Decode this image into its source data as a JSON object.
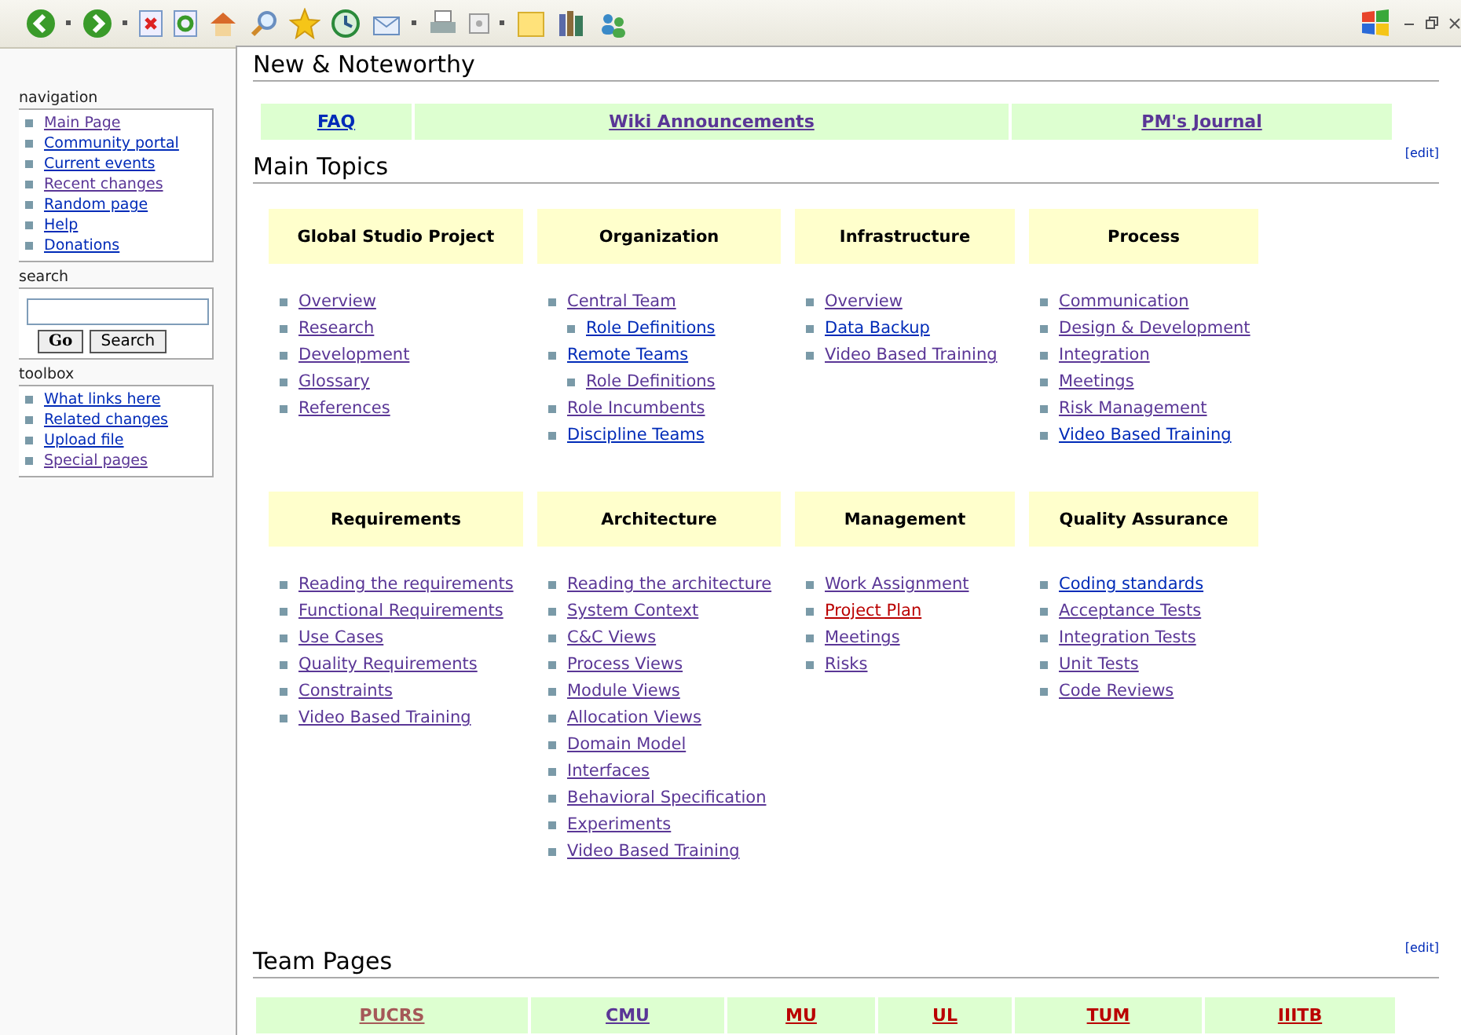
{
  "sidebar": {
    "portlets": [
      {
        "kind": "links",
        "title": "navigation",
        "links": [
          {
            "label": "Main Page",
            "kind": "visited"
          },
          {
            "label": "Community portal",
            "kind": "unvisited"
          },
          {
            "label": "Current events",
            "kind": "unvisited"
          },
          {
            "label": "Recent changes",
            "kind": "visited"
          },
          {
            "label": "Random page",
            "kind": "unvisited"
          },
          {
            "label": "Help",
            "kind": "unvisited"
          },
          {
            "label": "Donations",
            "kind": "unvisited"
          }
        ]
      },
      {
        "kind": "search",
        "title": "search",
        "buttons": [
          "Go",
          "Search"
        ]
      },
      {
        "kind": "links",
        "title": "toolbox",
        "links": [
          {
            "label": "What links here",
            "kind": "unvisited"
          },
          {
            "label": "Related changes",
            "kind": "unvisited"
          },
          {
            "label": "Upload file",
            "kind": "unvisited"
          },
          {
            "label": "Special pages",
            "kind": "visited"
          }
        ]
      }
    ]
  },
  "noteworthy": {
    "heading": "New & Noteworthy",
    "links": [
      {
        "label": "FAQ",
        "kind": "unvisited"
      },
      {
        "label": "Wiki Announcements",
        "kind": "visited"
      },
      {
        "label": "PM's Journal",
        "kind": "visited"
      }
    ]
  },
  "main_topics": {
    "heading": "Main Topics",
    "edit": "[edit]",
    "topics": [
      {
        "title": "Global Studio Project",
        "links": [
          {
            "label": "Overview",
            "kind": "visited"
          },
          {
            "label": "Research",
            "kind": "visited"
          },
          {
            "label": "Development",
            "kind": "visited"
          },
          {
            "label": "Glossary",
            "kind": "visited"
          },
          {
            "label": "References",
            "kind": "visited"
          }
        ]
      },
      {
        "title": "Organization",
        "links": [
          {
            "label": "Central Team",
            "kind": "visited",
            "children": [
              {
                "label": "Role Definitions",
                "kind": "unvisited"
              }
            ]
          },
          {
            "label": "Remote Teams",
            "kind": "unvisited",
            "children": [
              {
                "label": "Role Definitions",
                "kind": "visited"
              }
            ]
          },
          {
            "label": "Role Incumbents",
            "kind": "visited"
          },
          {
            "label": "Discipline Teams",
            "kind": "unvisited"
          }
        ]
      },
      {
        "title": "Infrastructure",
        "links": [
          {
            "label": "Overview",
            "kind": "visited"
          },
          {
            "label": "Data Backup",
            "kind": "unvisited"
          },
          {
            "label": "Video Based Training",
            "kind": "visited"
          }
        ]
      },
      {
        "title": "Process",
        "links": [
          {
            "label": "Communication",
            "kind": "visited"
          },
          {
            "label": "Design & Development",
            "kind": "visited"
          },
          {
            "label": "Integration",
            "kind": "visited"
          },
          {
            "label": "Meetings",
            "kind": "visited"
          },
          {
            "label": "Risk Management",
            "kind": "visited"
          },
          {
            "label": "Video Based Training",
            "kind": "unvisited"
          }
        ]
      },
      {
        "title": "Requirements",
        "links": [
          {
            "label": "Reading the requirements",
            "kind": "visited"
          },
          {
            "label": "Functional Requirements",
            "kind": "visited"
          },
          {
            "label": "Use Cases",
            "kind": "visited"
          },
          {
            "label": "Quality Requirements",
            "kind": "visited"
          },
          {
            "label": "Constraints",
            "kind": "visited"
          },
          {
            "label": "Video Based Training",
            "kind": "visited"
          }
        ]
      },
      {
        "title": "Architecture",
        "links": [
          {
            "label": "Reading the architecture",
            "kind": "visited"
          },
          {
            "label": "System Context",
            "kind": "visited"
          },
          {
            "label": "C&C Views",
            "kind": "visited"
          },
          {
            "label": "Process Views",
            "kind": "visited"
          },
          {
            "label": "Module Views",
            "kind": "visited"
          },
          {
            "label": "Allocation Views",
            "kind": "visited"
          },
          {
            "label": "Domain Model",
            "kind": "visited"
          },
          {
            "label": "Interfaces",
            "kind": "visited"
          },
          {
            "label": "Behavioral Specification",
            "kind": "visited"
          },
          {
            "label": "Experiments",
            "kind": "visited"
          },
          {
            "label": "Video Based Training",
            "kind": "visited"
          }
        ]
      },
      {
        "title": "Management",
        "links": [
          {
            "label": "Work Assignment",
            "kind": "visited"
          },
          {
            "label": "Project Plan",
            "kind": "new"
          },
          {
            "label": "Meetings",
            "kind": "visited"
          },
          {
            "label": "Risks",
            "kind": "visited"
          }
        ]
      },
      {
        "title": "Quality Assurance",
        "links": [
          {
            "label": "Coding standards",
            "kind": "unvisited"
          },
          {
            "label": "Acceptance Tests",
            "kind": "visited"
          },
          {
            "label": "Integration Tests",
            "kind": "visited"
          },
          {
            "label": "Unit Tests",
            "kind": "visited"
          },
          {
            "label": "Code Reviews",
            "kind": "visited"
          }
        ]
      }
    ]
  },
  "team_pages": {
    "heading": "Team Pages",
    "edit": "[edit]",
    "links": [
      {
        "label": "PUCRS",
        "kind": "visited_new"
      },
      {
        "label": "CMU",
        "kind": "visited"
      },
      {
        "label": "MU",
        "kind": "new"
      },
      {
        "label": "UL",
        "kind": "new"
      },
      {
        "label": "TUM",
        "kind": "new"
      },
      {
        "label": "IIITB",
        "kind": "new"
      }
    ]
  }
}
